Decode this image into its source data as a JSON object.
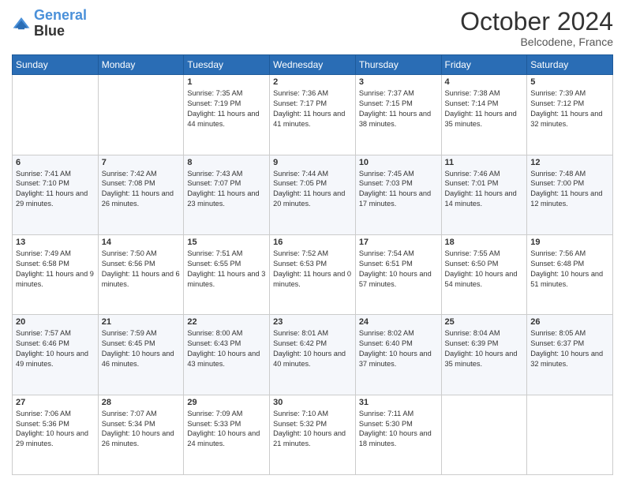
{
  "logo": {
    "line1": "General",
    "line2": "Blue"
  },
  "header": {
    "month": "October 2024",
    "location": "Belcodene, France"
  },
  "weekdays": [
    "Sunday",
    "Monday",
    "Tuesday",
    "Wednesday",
    "Thursday",
    "Friday",
    "Saturday"
  ],
  "weeks": [
    [
      {
        "day": "",
        "info": ""
      },
      {
        "day": "",
        "info": ""
      },
      {
        "day": "1",
        "info": "Sunrise: 7:35 AM\nSunset: 7:19 PM\nDaylight: 11 hours and 44 minutes."
      },
      {
        "day": "2",
        "info": "Sunrise: 7:36 AM\nSunset: 7:17 PM\nDaylight: 11 hours and 41 minutes."
      },
      {
        "day": "3",
        "info": "Sunrise: 7:37 AM\nSunset: 7:15 PM\nDaylight: 11 hours and 38 minutes."
      },
      {
        "day": "4",
        "info": "Sunrise: 7:38 AM\nSunset: 7:14 PM\nDaylight: 11 hours and 35 minutes."
      },
      {
        "day": "5",
        "info": "Sunrise: 7:39 AM\nSunset: 7:12 PM\nDaylight: 11 hours and 32 minutes."
      }
    ],
    [
      {
        "day": "6",
        "info": "Sunrise: 7:41 AM\nSunset: 7:10 PM\nDaylight: 11 hours and 29 minutes."
      },
      {
        "day": "7",
        "info": "Sunrise: 7:42 AM\nSunset: 7:08 PM\nDaylight: 11 hours and 26 minutes."
      },
      {
        "day": "8",
        "info": "Sunrise: 7:43 AM\nSunset: 7:07 PM\nDaylight: 11 hours and 23 minutes."
      },
      {
        "day": "9",
        "info": "Sunrise: 7:44 AM\nSunset: 7:05 PM\nDaylight: 11 hours and 20 minutes."
      },
      {
        "day": "10",
        "info": "Sunrise: 7:45 AM\nSunset: 7:03 PM\nDaylight: 11 hours and 17 minutes."
      },
      {
        "day": "11",
        "info": "Sunrise: 7:46 AM\nSunset: 7:01 PM\nDaylight: 11 hours and 14 minutes."
      },
      {
        "day": "12",
        "info": "Sunrise: 7:48 AM\nSunset: 7:00 PM\nDaylight: 11 hours and 12 minutes."
      }
    ],
    [
      {
        "day": "13",
        "info": "Sunrise: 7:49 AM\nSunset: 6:58 PM\nDaylight: 11 hours and 9 minutes."
      },
      {
        "day": "14",
        "info": "Sunrise: 7:50 AM\nSunset: 6:56 PM\nDaylight: 11 hours and 6 minutes."
      },
      {
        "day": "15",
        "info": "Sunrise: 7:51 AM\nSunset: 6:55 PM\nDaylight: 11 hours and 3 minutes."
      },
      {
        "day": "16",
        "info": "Sunrise: 7:52 AM\nSunset: 6:53 PM\nDaylight: 11 hours and 0 minutes."
      },
      {
        "day": "17",
        "info": "Sunrise: 7:54 AM\nSunset: 6:51 PM\nDaylight: 10 hours and 57 minutes."
      },
      {
        "day": "18",
        "info": "Sunrise: 7:55 AM\nSunset: 6:50 PM\nDaylight: 10 hours and 54 minutes."
      },
      {
        "day": "19",
        "info": "Sunrise: 7:56 AM\nSunset: 6:48 PM\nDaylight: 10 hours and 51 minutes."
      }
    ],
    [
      {
        "day": "20",
        "info": "Sunrise: 7:57 AM\nSunset: 6:46 PM\nDaylight: 10 hours and 49 minutes."
      },
      {
        "day": "21",
        "info": "Sunrise: 7:59 AM\nSunset: 6:45 PM\nDaylight: 10 hours and 46 minutes."
      },
      {
        "day": "22",
        "info": "Sunrise: 8:00 AM\nSunset: 6:43 PM\nDaylight: 10 hours and 43 minutes."
      },
      {
        "day": "23",
        "info": "Sunrise: 8:01 AM\nSunset: 6:42 PM\nDaylight: 10 hours and 40 minutes."
      },
      {
        "day": "24",
        "info": "Sunrise: 8:02 AM\nSunset: 6:40 PM\nDaylight: 10 hours and 37 minutes."
      },
      {
        "day": "25",
        "info": "Sunrise: 8:04 AM\nSunset: 6:39 PM\nDaylight: 10 hours and 35 minutes."
      },
      {
        "day": "26",
        "info": "Sunrise: 8:05 AM\nSunset: 6:37 PM\nDaylight: 10 hours and 32 minutes."
      }
    ],
    [
      {
        "day": "27",
        "info": "Sunrise: 7:06 AM\nSunset: 5:36 PM\nDaylight: 10 hours and 29 minutes."
      },
      {
        "day": "28",
        "info": "Sunrise: 7:07 AM\nSunset: 5:34 PM\nDaylight: 10 hours and 26 minutes."
      },
      {
        "day": "29",
        "info": "Sunrise: 7:09 AM\nSunset: 5:33 PM\nDaylight: 10 hours and 24 minutes."
      },
      {
        "day": "30",
        "info": "Sunrise: 7:10 AM\nSunset: 5:32 PM\nDaylight: 10 hours and 21 minutes."
      },
      {
        "day": "31",
        "info": "Sunrise: 7:11 AM\nSunset: 5:30 PM\nDaylight: 10 hours and 18 minutes."
      },
      {
        "day": "",
        "info": ""
      },
      {
        "day": "",
        "info": ""
      }
    ]
  ]
}
